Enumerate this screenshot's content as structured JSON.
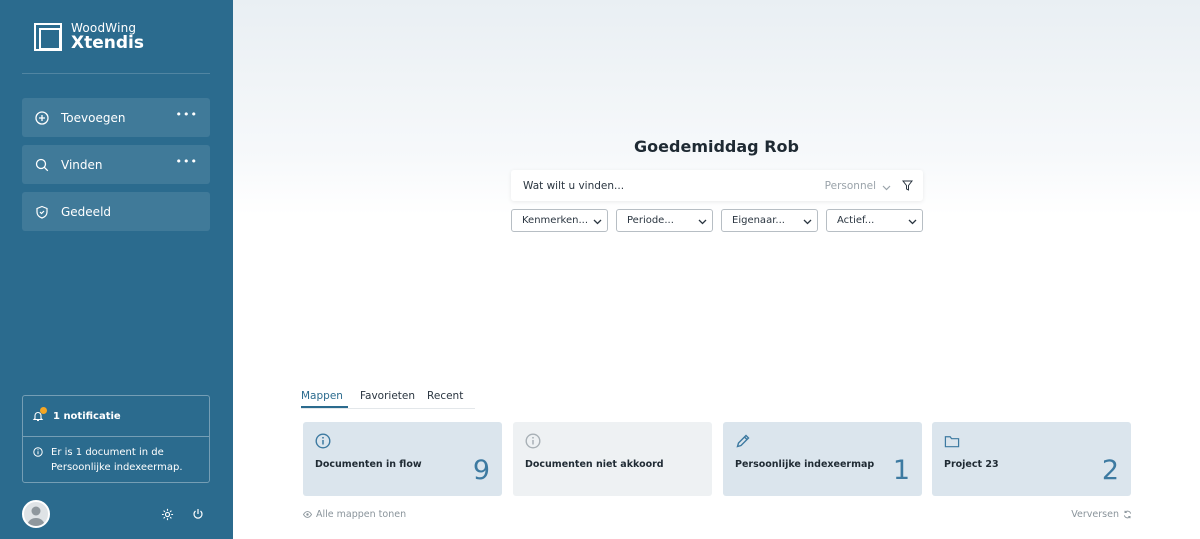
{
  "brand": {
    "top": "WoodWing",
    "bottom": "Xtendis"
  },
  "sidebar": {
    "items": [
      {
        "label": "Toevoegen",
        "icon": "plus-circle-icon",
        "more": "•••"
      },
      {
        "label": "Vinden",
        "icon": "search-icon",
        "more": "•••"
      },
      {
        "label": "Gedeeld",
        "icon": "shield-icon"
      }
    ],
    "notification": {
      "title": "1 notificatie",
      "message": "Er is 1 document in de Persoonlijke indexeermap."
    },
    "footer": {
      "settings_icon": "gear-icon",
      "logout_icon": "power-icon"
    }
  },
  "main": {
    "greeting": "Goedemiddag Rob",
    "search": {
      "placeholder": "Wat wilt u vinden...",
      "scope": "Personnel"
    },
    "filters": [
      "Kenmerken...",
      "Periode...",
      "Eigenaar...",
      "Actief..."
    ],
    "tabs": [
      {
        "label": "Mappen",
        "active": true
      },
      {
        "label": "Favorieten",
        "active": false
      },
      {
        "label": "Recent",
        "active": false
      }
    ],
    "cards": [
      {
        "title": "Documenten in flow",
        "count": "9",
        "icon": "info-icon"
      },
      {
        "title": "Documenten niet akkoord",
        "count": "",
        "icon": "info-icon"
      },
      {
        "title": "Persoonlijke indexeermap",
        "count": "1",
        "icon": "pencil-icon"
      },
      {
        "title": "Project 23",
        "count": "2",
        "icon": "folder-icon"
      }
    ],
    "show_all": "Alle mappen tonen",
    "refresh": "Verversen"
  },
  "colors": {
    "sidebar": "#2b6b8e",
    "accent": "#3d7aa1",
    "card": "#dbe5ed",
    "card_muted": "#eef1f3",
    "badge": "#f5a623"
  }
}
